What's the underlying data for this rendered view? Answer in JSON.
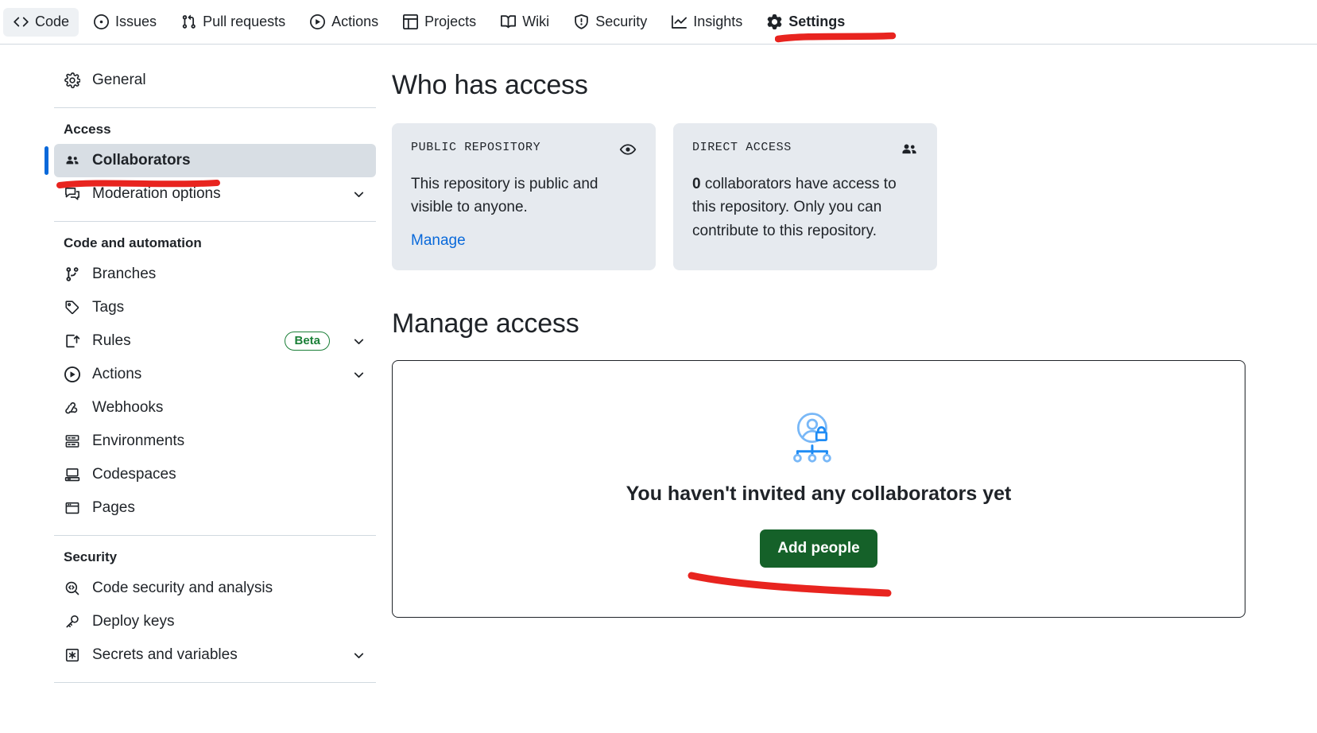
{
  "repo_nav": {
    "items": [
      {
        "label": "Code",
        "icon": "code-icon",
        "selected": true,
        "active": false
      },
      {
        "label": "Issues",
        "icon": "issue-opened-icon",
        "selected": false,
        "active": false
      },
      {
        "label": "Pull requests",
        "icon": "git-pull-request-icon",
        "selected": false,
        "active": false
      },
      {
        "label": "Actions",
        "icon": "play-icon",
        "selected": false,
        "active": false
      },
      {
        "label": "Projects",
        "icon": "table-icon",
        "selected": false,
        "active": false
      },
      {
        "label": "Wiki",
        "icon": "book-icon",
        "selected": false,
        "active": false
      },
      {
        "label": "Security",
        "icon": "shield-icon",
        "selected": false,
        "active": false
      },
      {
        "label": "Insights",
        "icon": "graph-icon",
        "selected": false,
        "active": false
      },
      {
        "label": "Settings",
        "icon": "gear-icon",
        "selected": false,
        "active": true
      }
    ]
  },
  "sidebar": {
    "general": {
      "label": "General",
      "icon": "gear-icon"
    },
    "groups": [
      {
        "title": "Access",
        "items": [
          {
            "label": "Collaborators",
            "icon": "people-icon",
            "current": true,
            "chevron": false,
            "badge": null
          },
          {
            "label": "Moderation options",
            "icon": "comment-discussion-icon",
            "current": false,
            "chevron": true,
            "badge": null
          }
        ]
      },
      {
        "title": "Code and automation",
        "items": [
          {
            "label": "Branches",
            "icon": "git-branch-icon",
            "current": false,
            "chevron": false,
            "badge": null
          },
          {
            "label": "Tags",
            "icon": "tag-icon",
            "current": false,
            "chevron": false,
            "badge": null
          },
          {
            "label": "Rules",
            "icon": "rules-icon",
            "current": false,
            "chevron": true,
            "badge": "Beta"
          },
          {
            "label": "Actions",
            "icon": "play-icon",
            "current": false,
            "chevron": true,
            "badge": null
          },
          {
            "label": "Webhooks",
            "icon": "webhook-icon",
            "current": false,
            "chevron": false,
            "badge": null
          },
          {
            "label": "Environments",
            "icon": "server-icon",
            "current": false,
            "chevron": false,
            "badge": null
          },
          {
            "label": "Codespaces",
            "icon": "codespaces-icon",
            "current": false,
            "chevron": false,
            "badge": null
          },
          {
            "label": "Pages",
            "icon": "browser-icon",
            "current": false,
            "chevron": false,
            "badge": null
          }
        ]
      },
      {
        "title": "Security",
        "items": [
          {
            "label": "Code security and analysis",
            "icon": "codescan-icon",
            "current": false,
            "chevron": false,
            "badge": null
          },
          {
            "label": "Deploy keys",
            "icon": "key-icon",
            "current": false,
            "chevron": false,
            "badge": null
          },
          {
            "label": "Secrets and variables",
            "icon": "asterisk-icon",
            "current": false,
            "chevron": true,
            "badge": null
          }
        ]
      }
    ]
  },
  "main": {
    "who_has_access_title": "Who has access",
    "cards": [
      {
        "kicker": "PUBLIC REPOSITORY",
        "icon": "eye-icon",
        "body": "This repository is public and visible to anyone.",
        "link": "Manage"
      },
      {
        "kicker": "DIRECT ACCESS",
        "icon": "people-icon",
        "body_strong": "0",
        "body": " collaborators have access to this repository. Only you can contribute to this repository."
      }
    ],
    "manage_access_title": "Manage access",
    "empty_state": {
      "illustration": "person-lock-org-chart-illustration",
      "title": "You haven't invited any collaborators yet",
      "button": "Add people"
    }
  },
  "annotations": {
    "color": "#e8241f",
    "marks": [
      {
        "name": "underline-settings-tab"
      },
      {
        "name": "underline-collaborators-item"
      },
      {
        "name": "underline-add-people-button"
      }
    ]
  }
}
